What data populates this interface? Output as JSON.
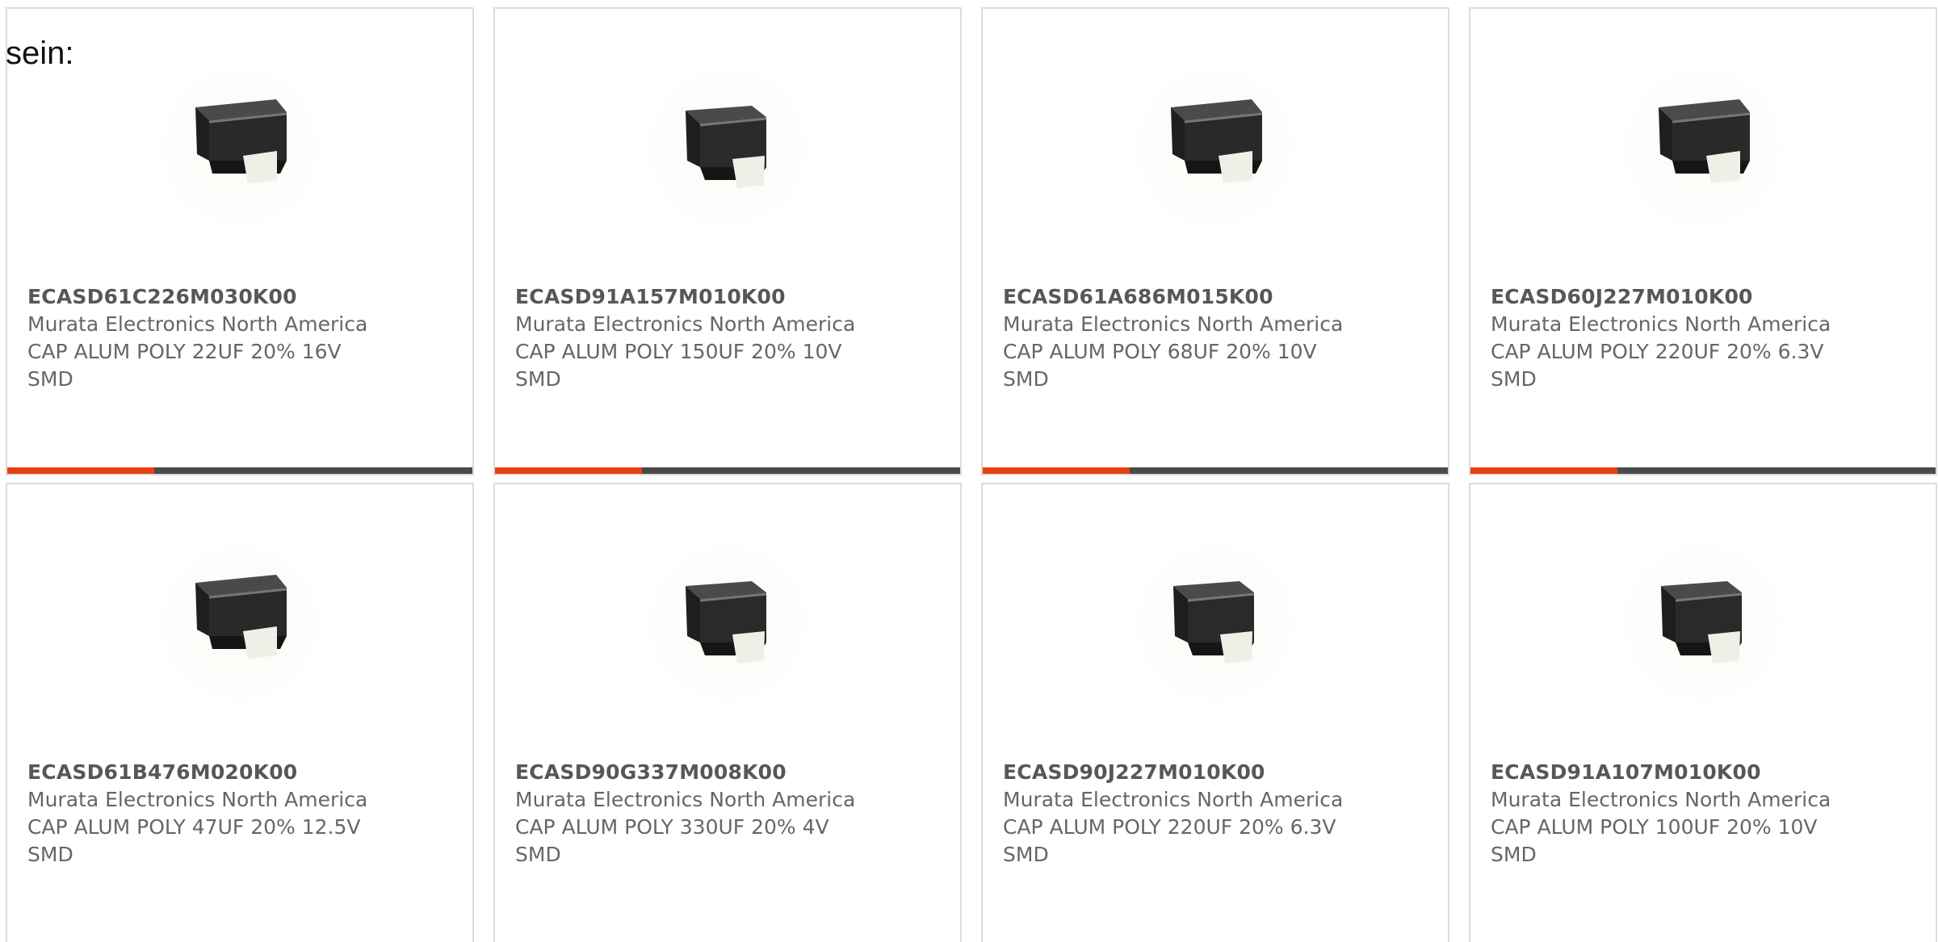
{
  "intro_text": "sein:",
  "colors": {
    "accent": "#e8410f",
    "bar_dark": "#4a4a4a",
    "card_border": "#dcdcdc",
    "text_muted": "#666666"
  },
  "products": [
    {
      "part_number": "ECASD61C226M030K00",
      "manufacturer": "Murata Electronics North America",
      "description": "CAP ALUM POLY 22UF 20% 16V\nSMD",
      "image_icon": "smd-capacitor-image"
    },
    {
      "part_number": "ECASD91A157M010K00",
      "manufacturer": "Murata Electronics North America",
      "description": "CAP ALUM POLY 150UF 20% 10V\nSMD",
      "image_icon": "smd-capacitor-image"
    },
    {
      "part_number": "ECASD61A686M015K00",
      "manufacturer": "Murata Electronics North America",
      "description": "CAP ALUM POLY 68UF 20% 10V\nSMD",
      "image_icon": "smd-capacitor-image"
    },
    {
      "part_number": "ECASD60J227M010K00",
      "manufacturer": "Murata Electronics North America",
      "description": "CAP ALUM POLY 220UF 20% 6.3V\nSMD",
      "image_icon": "smd-capacitor-image"
    },
    {
      "part_number": "ECASD61B476M020K00",
      "manufacturer": "Murata Electronics North America",
      "description": "CAP ALUM POLY 47UF 20% 12.5V\nSMD",
      "image_icon": "smd-capacitor-image"
    },
    {
      "part_number": "ECASD90G337M008K00",
      "manufacturer": "Murata Electronics North America",
      "description": "CAP ALUM POLY 330UF 20% 4V\nSMD",
      "image_icon": "smd-capacitor-image"
    },
    {
      "part_number": "ECASD90J227M010K00",
      "manufacturer": "Murata Electronics North America",
      "description": "CAP ALUM POLY 220UF 20% 6.3V\nSMD",
      "image_icon": "smd-capacitor-image"
    },
    {
      "part_number": "ECASD91A107M010K00",
      "manufacturer": "Murata Electronics North America",
      "description": "CAP ALUM POLY 100UF 20% 10V\nSMD",
      "image_icon": "smd-capacitor-image"
    }
  ]
}
